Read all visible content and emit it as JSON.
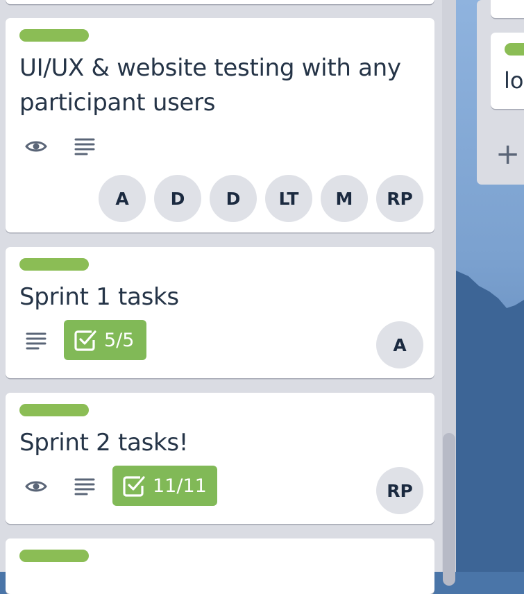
{
  "board": {
    "cards": [
      {
        "id": "uiux",
        "label_color": "#8bbd55",
        "title": "UI/UX & website testing with any participant users",
        "badges": [
          "eye-icon",
          "description-icon"
        ],
        "members": [
          "A",
          "D",
          "D",
          "LT",
          "M",
          "RP"
        ]
      },
      {
        "id": "sprint1",
        "label_color": "#8bbd55",
        "title": "Sprint 1 tasks",
        "badges": [
          "description-icon"
        ],
        "checklist": "5/5",
        "members": [
          "A"
        ]
      },
      {
        "id": "sprint2",
        "label_color": "#8bbd55",
        "title": "Sprint 2 tasks!",
        "badges": [
          "eye-icon",
          "description-icon"
        ],
        "checklist": "11/11",
        "members": [
          "RP"
        ]
      },
      {
        "id": "bottom",
        "label_color": "#8bbd55"
      }
    ],
    "right_list": {
      "card_title_partial": "lo",
      "add_icon": "plus-icon",
      "add_symbol": "+"
    }
  },
  "colors": {
    "label_green": "#8bbd55",
    "checklist_complete": "#81b957",
    "avatar_bg": "#dfe1e7",
    "list_bg": "#dadce3"
  }
}
